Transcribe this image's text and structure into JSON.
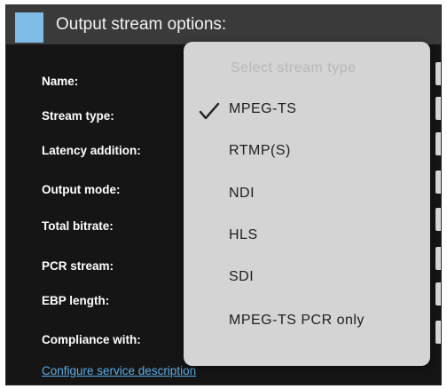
{
  "header": {
    "title": "Output stream options:",
    "accent_color": "#7fbde8"
  },
  "form": {
    "labels": [
      "Name:",
      "Stream type:",
      "Latency addition:",
      "Output mode:",
      "Total bitrate:",
      "PCR stream:",
      "EBP length:",
      "Compliance with:"
    ],
    "configure_link": "Configure service description"
  },
  "dropdown": {
    "placeholder": "Select stream type",
    "selected": "MPEG-TS",
    "options": [
      "MPEG-TS",
      "RTMP(S)",
      "NDI",
      "HLS",
      "SDI",
      "MPEG-TS PCR only"
    ],
    "selected_icon": "check-icon"
  },
  "colors": {
    "panel_background": "#151515",
    "header_background": "#3a3a3a",
    "link": "#5aaee6",
    "dropdown_background": "#d4d4d4"
  }
}
